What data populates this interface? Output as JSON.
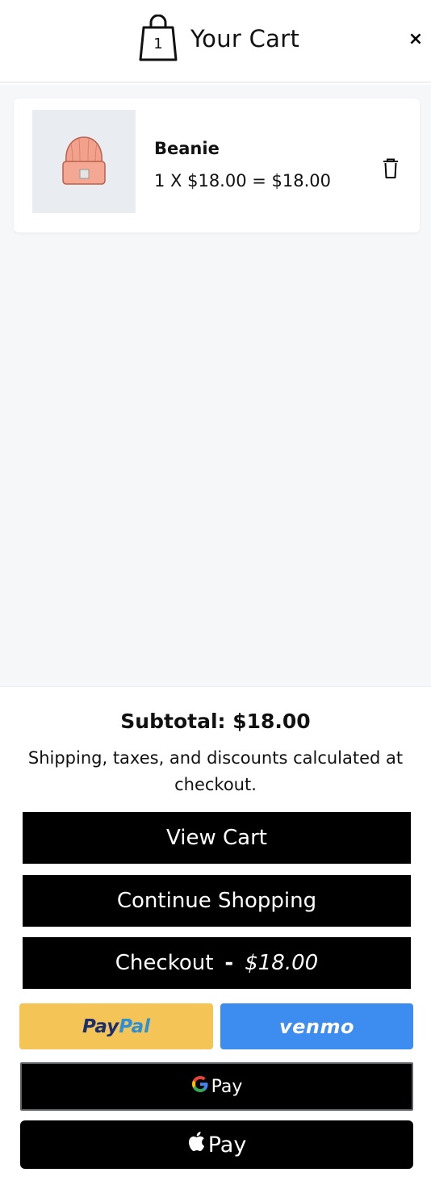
{
  "header": {
    "title": "Your Cart",
    "cart_count": "1",
    "close_label": "×"
  },
  "items": [
    {
      "name": "Beanie",
      "quantity_price": "1 X $18.00 = $18.00",
      "icon": "trash-icon"
    }
  ],
  "footer": {
    "subtotal": "Subtotal: $18.00",
    "note": "Shipping, taxes, and discounts calculated at checkout.",
    "view_cart_label": "View Cart",
    "continue_label": "Continue Shopping",
    "checkout_label": "Checkout",
    "checkout_separator": "-",
    "checkout_amount": "$18.00"
  },
  "payments": {
    "paypal_a": "Pay",
    "paypal_b": "Pal",
    "venmo": "venmo",
    "gpay_text": "Pay",
    "apple_text": "Pay"
  },
  "colors": {
    "paypal_bg": "#f4c456",
    "venmo_bg": "#3d8cf0",
    "button_bg": "#000000",
    "content_bg": "#f6f7f9"
  }
}
